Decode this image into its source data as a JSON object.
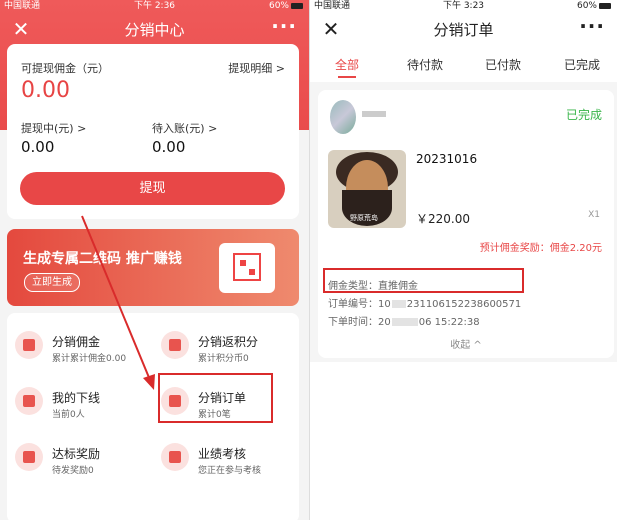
{
  "left": {
    "status": {
      "carrier": "中国联通",
      "time": "下午 2:36",
      "battery": "60%"
    },
    "title": "分销中心",
    "wallet": {
      "withdrawable_label": "可提现佣金（元）",
      "withdrawable_value": "0.00",
      "detail_link": "提现明细 >",
      "pending_label": "提现中(元) >",
      "pending_value": "0.00",
      "incoming_label": "待入账(元) >",
      "incoming_value": "0.00",
      "withdraw_button": "提现"
    },
    "banner": {
      "text": "生成专属二维码  推广赚钱",
      "button": "立即生成"
    },
    "menu": [
      {
        "name": "分销佣金",
        "sub": "累计累计佣金0.00"
      },
      {
        "name": "分销返积分",
        "sub": "累计积分币0"
      },
      {
        "name": "我的下线",
        "sub": "当前0人"
      },
      {
        "name": "分销订单",
        "sub": "累计0笔"
      },
      {
        "name": "达标奖励",
        "sub": "待发奖励0"
      },
      {
        "name": "业绩考核",
        "sub": "您正在参与考核"
      }
    ]
  },
  "right": {
    "status": {
      "carrier": "中国联通",
      "time": "下午 3:23",
      "battery": "60%"
    },
    "title": "分销订单",
    "tabs": [
      "全部",
      "待付款",
      "已付款",
      "已完成"
    ],
    "order": {
      "status": "已完成",
      "product_image_text": "野原荒岛",
      "product": "20231016",
      "price": "￥220.00",
      "qty": "X1",
      "commission": "预计佣金奖励：佣金2.20元",
      "commission_type": "佣金类型：直推佣金",
      "order_no_label": "订单编号：",
      "order_no_a": "10",
      "order_no_b": "231106152238600571",
      "order_time_label": "下单时间：",
      "order_time_a": "20",
      "order_time_b": "06 15:22:38",
      "fold": "收起 ^"
    }
  },
  "colors": {
    "accent": "#e84747",
    "highlight": "#d92b2b",
    "completed": "#39b54a"
  }
}
